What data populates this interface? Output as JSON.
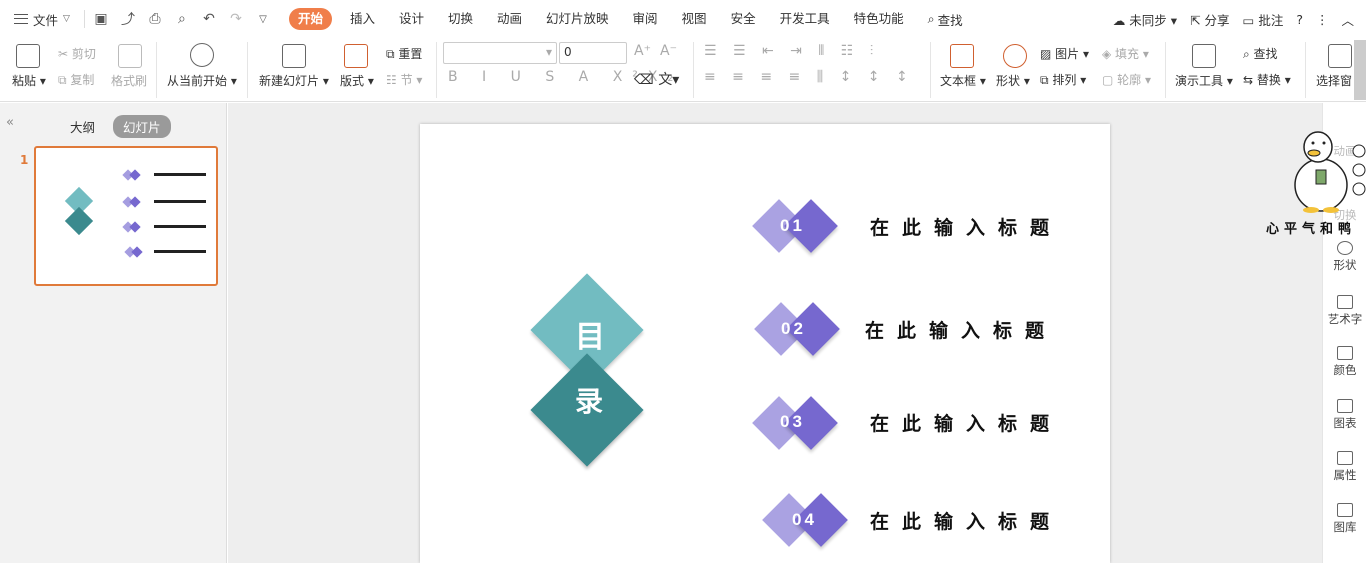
{
  "menu": {
    "file": "文件",
    "tabs": [
      "开始",
      "插入",
      "设计",
      "切换",
      "动画",
      "幻灯片放映",
      "审阅",
      "视图",
      "安全",
      "开发工具",
      "特色功能"
    ],
    "search": "查找",
    "sync": "未同步",
    "share": "分享",
    "comment": "批注",
    "help": "?"
  },
  "ribbon": {
    "paste": "粘贴",
    "cut": "剪切",
    "copy": "复制",
    "format_painter": "格式刷",
    "from_current": "从当前开始",
    "new_slide": "新建幻灯片",
    "layout": "版式",
    "reset": "重置",
    "section": "节",
    "font_size": "0",
    "textbox": "文本框",
    "shape": "形状",
    "picture": "图片",
    "fill": "填充",
    "arrange": "排列",
    "outline": "轮廓",
    "present_tools": "演示工具",
    "find": "查找",
    "replace": "替换",
    "select_pane": "选择窗"
  },
  "left_panel": {
    "tab_outline": "大纲",
    "tab_slides": "幻灯片",
    "slide_number": "1"
  },
  "slide": {
    "title_char1": "目",
    "title_char2": "录",
    "items": [
      {
        "num": "01",
        "text": "在此输入标题"
      },
      {
        "num": "02",
        "text": "在此输入标题"
      },
      {
        "num": "03",
        "text": "在此输入标题"
      },
      {
        "num": "04",
        "text": "在此输入标题"
      }
    ]
  },
  "right_panel": {
    "anim": "动画",
    "switch": "切换",
    "shape": "形状",
    "art": "艺术字",
    "color": "颜色",
    "chart": "图表",
    "props": "属性",
    "gallery": "图库"
  },
  "sticker_text": "心平气和鸭",
  "colors": {
    "accent": "#f07e4a",
    "teal_light": "#72bcc1",
    "teal_dark": "#3b8a8e",
    "purple_light": "#a59de0",
    "purple_dark": "#7668cf"
  }
}
